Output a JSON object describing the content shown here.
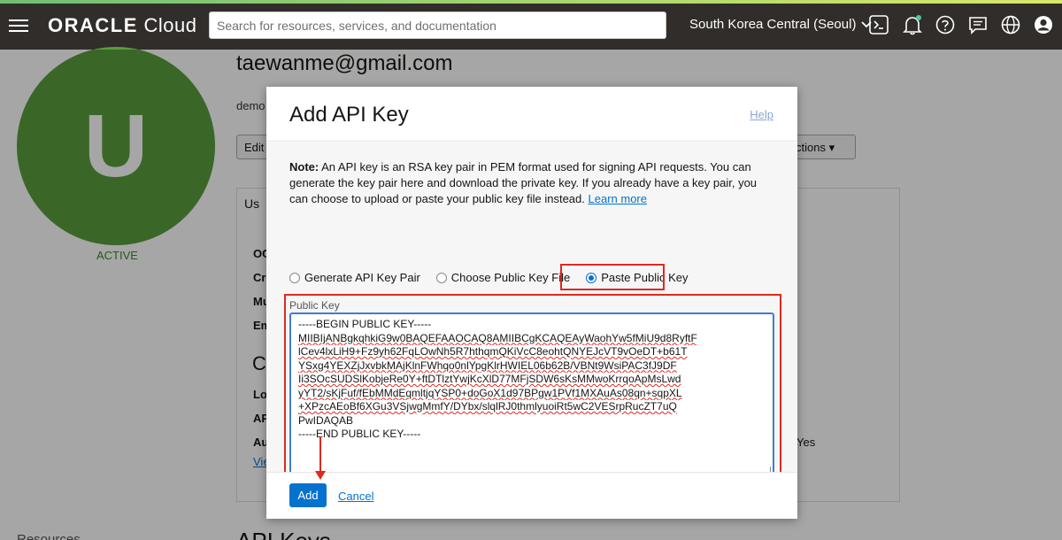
{
  "topnav": {
    "logo_bold": "ORACLE",
    "logo_light": "Cloud",
    "search_placeholder": "Search for resources, services, and documentation",
    "region": "South Korea Central (Seoul)",
    "icons": [
      "cloud-shell-icon",
      "bell-icon",
      "help-icon",
      "chat-icon",
      "globe-icon",
      "user-profile-icon"
    ]
  },
  "background": {
    "avatar_letter": "U",
    "avatar_status": "ACTIVE",
    "user_email": "taewanme@gmail.com",
    "description": "demo",
    "edit_label": "Edit",
    "actions_label": "ctions",
    "tab_label": "Us",
    "labels": [
      "OC",
      "Cr",
      "Mu",
      "Em"
    ],
    "section_heading": "C",
    "section_labels": [
      "Lo",
      "AP",
      "Au"
    ],
    "view_link": "Vie",
    "yes_value": "Yes",
    "resources_label": "Resources",
    "api_keys_heading": "API Keys"
  },
  "modal": {
    "title": "Add API Key",
    "help": "Help",
    "note_bold": "Note:",
    "note_text": " An API key is an RSA key pair in PEM format used for signing API requests. You can generate the key pair here and download the private key. If you already have a key pair, you can choose to upload or paste your public key file instead. ",
    "learn_more": "Learn more",
    "radio_options": [
      "Generate API Key Pair",
      "Choose Public Key File",
      "Paste Public Key"
    ],
    "selected_option": "Paste Public Key",
    "public_key_label": "Public Key",
    "public_key_lines": [
      "-----BEGIN PUBLIC KEY-----",
      "MIIBIjANBgkqhkiG9w0BAQEFAAOCAQ8AMIIBCgKCAQEAyWaohYw5fMiU9d8RyftF",
      "lCev4lxLiH9+Fz9yh62FqLOwNh5R7hthqmQKiVcC8eohtQNYEJcVT9vOeDT+b61T",
      "YSxg4YEXZjJxvbkMAjKlnFWhqo0nlYpgKlrHWIEL06b62B/VBNt9WsiPAC3fJ9DF",
      "Ii3SOcSUDSlKobjeRe0Y+ftDTlztYwjKcXlD77MFjSDW6sKsMMwoKrrqoApMsLwd",
      "yYT2/sKjFuf/fEbMMdEqmltjqYSP0+doGoX1d97BPgw1PVf1MXAuAs08qn+sqpXL",
      "+XPzcAEoBf6XGu3VSjwgMmfY/DYbx/slqlRJ0thmlyuoiRt5wC2VESrpRucZT7uQ",
      "PwIDAQAB",
      "-----END PUBLIC KEY-----"
    ],
    "add_label": "Add",
    "cancel_label": "Cancel"
  },
  "colors": {
    "nav_bg": "#312d2a",
    "accent": "#0572ce",
    "annotation": "#e0281f",
    "avatar": "#5a9e3c"
  }
}
